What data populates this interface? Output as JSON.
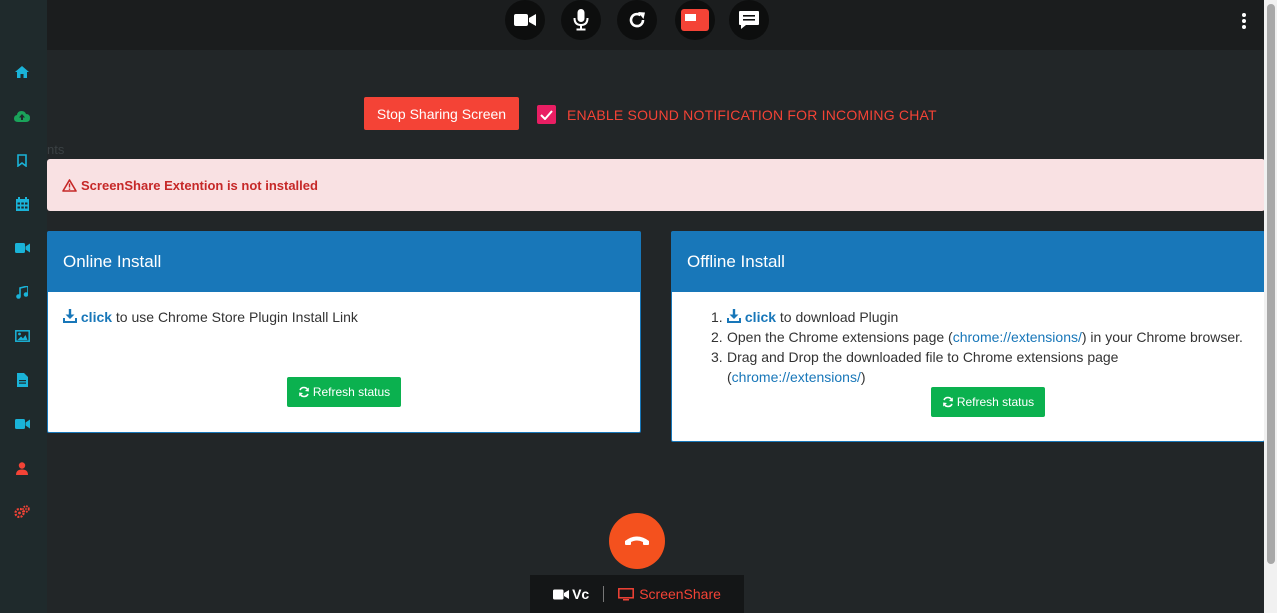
{
  "controls": {
    "stop_sharing_label": "Stop Sharing Screen",
    "sound_notification_label": "ENABLE SOUND NOTIFICATION FOR INCOMING CHAT",
    "sound_notification_checked": true
  },
  "ghost_text": "nts",
  "alert": {
    "text": "ScreenShare Extention is not installed",
    "icon": "warning-triangle-icon"
  },
  "online_install": {
    "title": "Online Install",
    "link_label": "click",
    "text": " to use Chrome Store Plugin Install Link",
    "refresh_label": "Refresh status"
  },
  "offline_install": {
    "title": "Offline Install",
    "steps": [
      {
        "num": "1.",
        "link": "click",
        "text": " to download Plugin"
      },
      {
        "num": "2.",
        "pre": "Open the Chrome extensions page (",
        "link": "chrome://extensions/",
        "post": ") in your Chrome browser."
      },
      {
        "num": "3.",
        "pre": "Drag and Drop the downloaded file to Chrome extensions page",
        "pre2": "(",
        "link": "chrome://extensions/",
        "post": ")"
      }
    ],
    "refresh_label": "Refresh status"
  },
  "bottom_tabs": {
    "vc_label": "Vc",
    "screenshare_label": "ScreenShare"
  },
  "colors": {
    "accent_blue": "#1877b9",
    "danger_red": "#f44336",
    "success_green": "#0bb14f",
    "sidebar_cyan": "#1ab3d8",
    "sidebar_green": "#1aa35a",
    "hangup_orange": "#f4511e",
    "checkbox_pink": "#e91e63"
  },
  "top_icons": [
    "video-camera-icon",
    "microphone-icon",
    "refresh-icon",
    "screen-share-icon",
    "chat-icon",
    "kebab-menu-icon"
  ],
  "sidebar_icons": [
    "home-icon",
    "cloud-upload-icon",
    "bookmark-icon",
    "calendar-icon",
    "video-camera-icon",
    "music-icon",
    "image-icon",
    "document-icon",
    "video-camera-icon",
    "user-icon",
    "gears-icon"
  ]
}
